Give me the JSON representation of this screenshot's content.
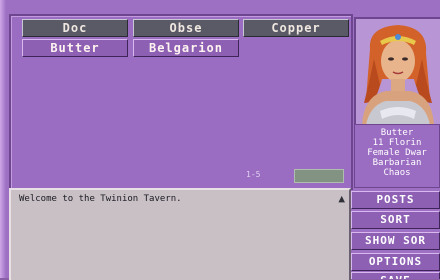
{
  "tabs": [
    {
      "label": "Doc"
    },
    {
      "label": "Obse"
    },
    {
      "label": "Copper"
    }
  ],
  "characters": [
    {
      "label": "Butter"
    },
    {
      "label": "Belgarion"
    }
  ],
  "page_indicator": "1-5",
  "selected_character": {
    "name": "Butter",
    "money": "11 Florin",
    "race": "Female Dwar",
    "class": "Barbarian",
    "alignment": "Chaos"
  },
  "log": {
    "message": "Welcome to the Twinion Tavern."
  },
  "side_buttons": [
    {
      "label": "POSTS"
    },
    {
      "label": "SORT"
    },
    {
      "label": "SHOW SOR"
    },
    {
      "label": "OPTIONS"
    },
    {
      "label": "SAVE"
    }
  ],
  "icons": {
    "scroll_up": "up-arrow-icon"
  },
  "colors": {
    "panel": "#9a6cc2",
    "tab": "#5a5a66",
    "log_bg": "#c8c0c4",
    "button": "#8e60b4"
  }
}
